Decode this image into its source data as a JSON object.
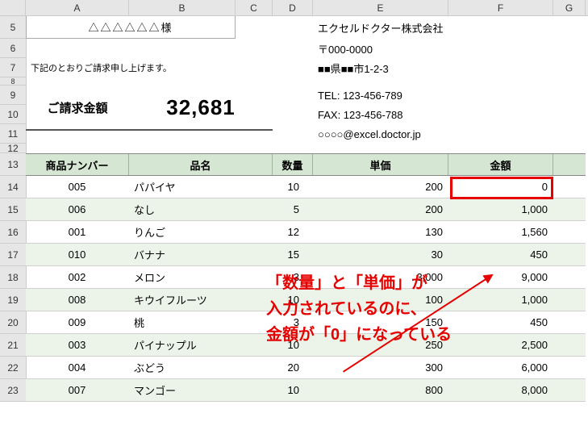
{
  "col_labels": [
    "A",
    "B",
    "C",
    "D",
    "E",
    "F",
    "G"
  ],
  "row_labels": [
    "5",
    "6",
    "7",
    "8",
    "9",
    "10",
    "11",
    "12",
    "13",
    "14",
    "15",
    "16",
    "17",
    "18",
    "19",
    "20",
    "21",
    "22",
    "23"
  ],
  "customer_name": "△△△△△△様",
  "notice_text": "下記のとおりご請求申し上げます。",
  "invoice": {
    "label": "ご請求金額",
    "amount": "32,681"
  },
  "company": {
    "name": "エクセルドクター株式会社",
    "postal": "〒000-0000",
    "address": "■■県■■市1-2-3",
    "tel": "TEL: 123-456-789",
    "fax": "FAX: 123-456-788",
    "email": "○○○○@excel.doctor.jp"
  },
  "headers": {
    "no": "商品ナンバー",
    "name": "品名",
    "qty": "数量",
    "price": "単価",
    "amount": "金額"
  },
  "items": [
    {
      "no": "005",
      "name": "パパイヤ",
      "qty": "10",
      "price": "200",
      "amount": "0"
    },
    {
      "no": "006",
      "name": "なし",
      "qty": "5",
      "price": "200",
      "amount": "1,000"
    },
    {
      "no": "001",
      "name": "りんご",
      "qty": "12",
      "price": "130",
      "amount": "1,560"
    },
    {
      "no": "010",
      "name": "バナナ",
      "qty": "15",
      "price": "30",
      "amount": "450"
    },
    {
      "no": "002",
      "name": "メロン",
      "qty": "3",
      "price": "3,000",
      "amount": "9,000"
    },
    {
      "no": "008",
      "name": "キウイフルーツ",
      "qty": "10",
      "price": "100",
      "amount": "1,000"
    },
    {
      "no": "009",
      "name": "桃",
      "qty": "3",
      "price": "150",
      "amount": "450"
    },
    {
      "no": "003",
      "name": "パイナップル",
      "qty": "10",
      "price": "250",
      "amount": "2,500"
    },
    {
      "no": "004",
      "name": "ぶどう",
      "qty": "20",
      "price": "300",
      "amount": "6,000"
    },
    {
      "no": "007",
      "name": "マンゴー",
      "qty": "10",
      "price": "800",
      "amount": "8,000"
    }
  ],
  "annotation": {
    "line1": "「数量」と「単価」が",
    "line2": "入力されているのに、",
    "line3": "金額が「0」になっている"
  }
}
